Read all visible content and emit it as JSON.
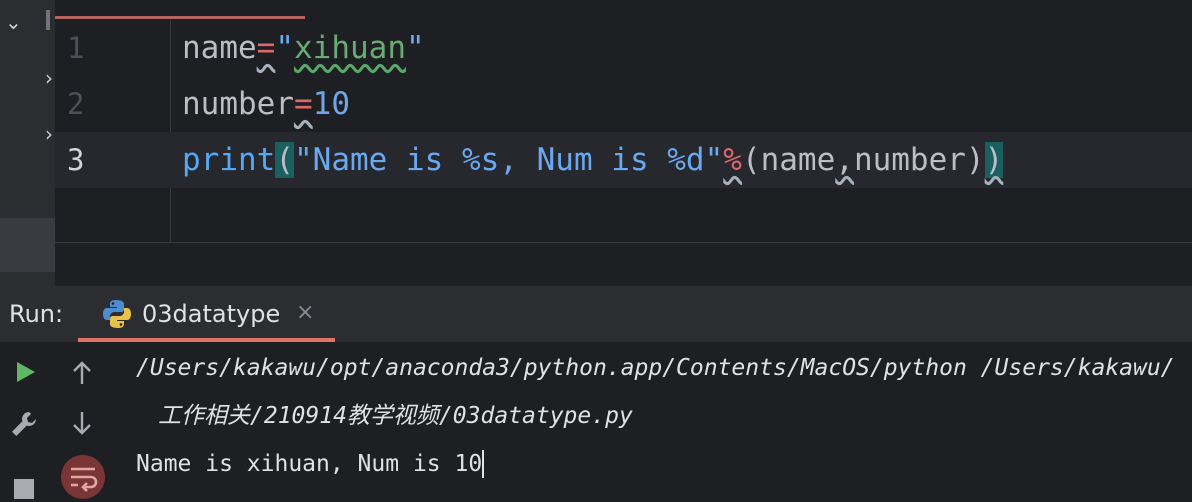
{
  "editor": {
    "lines": [
      {
        "number": "1",
        "var": "name",
        "op": "=",
        "q1": "\"",
        "text": "xihuan",
        "q2": "\""
      },
      {
        "number": "2",
        "var": "number",
        "op": "=",
        "value": "10"
      },
      {
        "number": "3",
        "fn": "print",
        "open": "(",
        "str": "\"Name is %s, Num is %d\"",
        "op": "%",
        "args_open": "(",
        "arg1": "name",
        "comma": ",",
        "arg2": "number",
        "args_close": ")",
        "close": ")"
      }
    ]
  },
  "run_panel": {
    "label": "Run:",
    "tab_label": "03datatype",
    "close_glyph": "×",
    "output": {
      "command_line1": "/Users/kakawu/opt/anaconda3/python.app/Contents/MacOS/python /Users/kakawu/",
      "command_line2": "工作相关/210914教学视频/03datatype.py",
      "result": "Name is xihuan, Num is 10"
    }
  },
  "colors": {
    "accent": "#e07566",
    "run_green": "#5fb865",
    "background": "#1e1f22"
  }
}
